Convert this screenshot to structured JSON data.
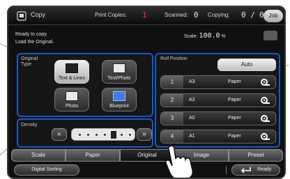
{
  "topbar": {
    "title": "Copy",
    "print_copies_label": "Print Copies:",
    "print_copies_value": "1",
    "scanned_label": "Scanned:",
    "scanned_value": "0",
    "copying_label": "Copying:",
    "copying_value": "0 /",
    "copying_total": "0",
    "job_label": "Job"
  },
  "messages": {
    "line1": "Ready to copy.",
    "line2": "Load the Original."
  },
  "scale": {
    "label": "Scale:",
    "value": "100.0",
    "unit": "%"
  },
  "original_type": {
    "label_line1": "Original",
    "label_line2": "Type",
    "options": [
      {
        "label": "Text & Lines",
        "selected": true
      },
      {
        "label": "Text/Photo",
        "selected": false
      },
      {
        "label": "Photo",
        "selected": false
      },
      {
        "label": "Blueprint",
        "selected": false
      }
    ]
  },
  "density": {
    "label": "Density",
    "left_arrow": "«",
    "right_arrow": "»",
    "level": 5,
    "steps": 7
  },
  "roll_position": {
    "label": "Roll Position",
    "auto_label": "Auto",
    "rolls": [
      {
        "num": "1",
        "size": "A3",
        "type": "Paper"
      },
      {
        "num": "2",
        "size": "A3",
        "type": "Paper"
      },
      {
        "num": "3",
        "size": "A0",
        "type": "Paper"
      },
      {
        "num": "4",
        "size": "A1",
        "type": "Paper"
      }
    ]
  },
  "tabs": [
    {
      "label": "Scale",
      "active": false
    },
    {
      "label": "Paper",
      "active": false
    },
    {
      "label": "Original",
      "active": true
    },
    {
      "label": "Image",
      "active": false
    },
    {
      "label": "Preset",
      "active": false
    }
  ],
  "bottom": {
    "digital_sorting": "Digital Sorting",
    "ready": "Ready"
  },
  "colors": {
    "accent_blue": "#1a58c8",
    "print_copies_value": "#ff3030"
  }
}
